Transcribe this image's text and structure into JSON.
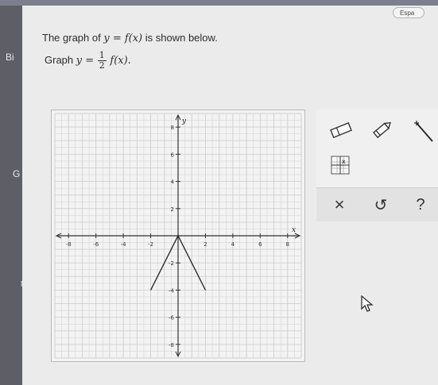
{
  "language_button": "Espa",
  "side_letters": [
    "Bi",
    "G",
    "N"
  ],
  "question": {
    "line1_prefix": "The graph of",
    "line1_math": "y = f(x)",
    "line1_suffix": "is shown below.",
    "line2_prefix": "Graph",
    "line2_lhs": "y =",
    "fraction_num": "1",
    "fraction_den": "2",
    "line2_rhs": "f(x)."
  },
  "chart_data": {
    "type": "line",
    "title": "",
    "xlabel": "x",
    "ylabel": "y",
    "xlim": [
      -9,
      9
    ],
    "ylim": [
      -9,
      9
    ],
    "grid": true,
    "x_ticks": [
      "-8",
      "-6",
      "-4",
      "-2",
      "2",
      "4",
      "6",
      "8"
    ],
    "y_ticks": [
      "8",
      "6",
      "4",
      "2",
      "-2",
      "-4",
      "-6",
      "-8"
    ],
    "series": [
      {
        "x": [
          -2,
          0,
          2
        ],
        "y": [
          -4,
          0,
          -4
        ]
      }
    ]
  },
  "tools": {
    "eraser": "eraser-icon",
    "pencil": "pencil-icon",
    "line": "line-segment-icon",
    "grid_tool": "grid-point-icon",
    "clear": "×",
    "undo": "↺",
    "help": "?"
  },
  "colors": {
    "grid": "#cfcfcf",
    "axis": "#333333",
    "curve": "#222222"
  }
}
